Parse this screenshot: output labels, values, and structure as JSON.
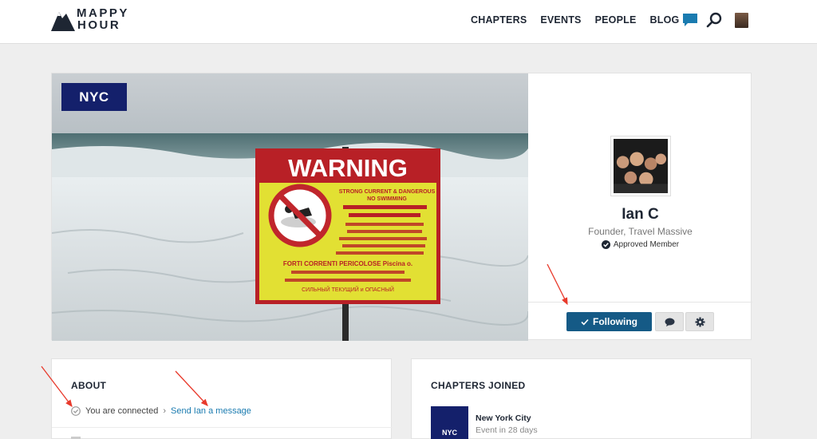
{
  "header": {
    "logo_line1": "MAPPY",
    "logo_line2": "HOUR",
    "nav": [
      "CHAPTERS",
      "EVENTS",
      "PEOPLE",
      "BLOG"
    ]
  },
  "hero": {
    "tag": "NYC",
    "sign": {
      "title": "WARNING",
      "text1": "STRONG CURRENT & DANGEROUS",
      "text2": "NO SWIMMING",
      "text3": "FORTI CORRENTI PERICOLOSE Piscina o.",
      "text4": "СИЛЬНЫЙ ТЕКУЩИЙ и ОПАСНЫЙ"
    }
  },
  "profile": {
    "name": "Ian C",
    "title": "Founder, Travel Massive",
    "badge": "Approved Member",
    "follow_label": "Following"
  },
  "about": {
    "heading": "ABOUT",
    "connected": "You are connected",
    "separator": "›",
    "message_link": "Send Ian a message"
  },
  "chapters": {
    "heading": "CHAPTERS JOINED",
    "items": [
      {
        "thumb": "NYC",
        "name": "New York City",
        "sub": "Event in 28 days"
      }
    ]
  },
  "colors": {
    "brand_navy": "#14206b",
    "button_blue": "#155a86",
    "link_blue": "#1a7bb0",
    "annotation_red": "#e8392b"
  }
}
